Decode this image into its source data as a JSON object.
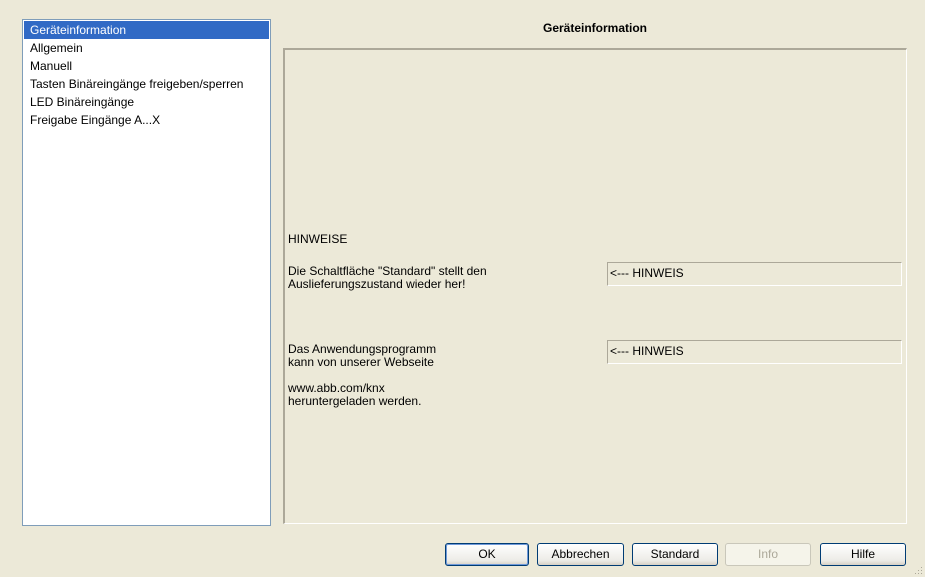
{
  "sidebar": {
    "items": [
      {
        "label": "Geräteinformation"
      },
      {
        "label": "Allgemein"
      },
      {
        "label": "Manuell"
      },
      {
        "label": "Tasten Binäreingänge freigeben/sperren"
      },
      {
        "label": "LED Binäreingänge"
      },
      {
        "label": "Freigabe Eingänge A...X"
      }
    ],
    "selected_index": 0
  },
  "main": {
    "title": "Geräteinformation",
    "hinweise_heading": "HINWEISE",
    "note1_line1": "Die Schaltfläche \"Standard\" stellt den",
    "note1_line2": "Auslieferungszustand wieder her!",
    "note1_value": "<--- HINWEIS",
    "note2_line1": "Das Anwendungsprogramm",
    "note2_line2": "kann von unserer Webseite",
    "note2_value": "<--- HINWEIS",
    "note3_line1": "www.abb.com/knx",
    "note3_line2": "heruntergeladen werden."
  },
  "buttons": {
    "ok": "OK",
    "cancel": "Abbrechen",
    "standard": "Standard",
    "info": "Info",
    "help": "Hilfe"
  },
  "colors": {
    "background": "#ece9d8",
    "selection": "#316ac5",
    "border": "#7f9db9"
  },
  "icons": {
    "resize_grip": "resize-grip-icon"
  }
}
